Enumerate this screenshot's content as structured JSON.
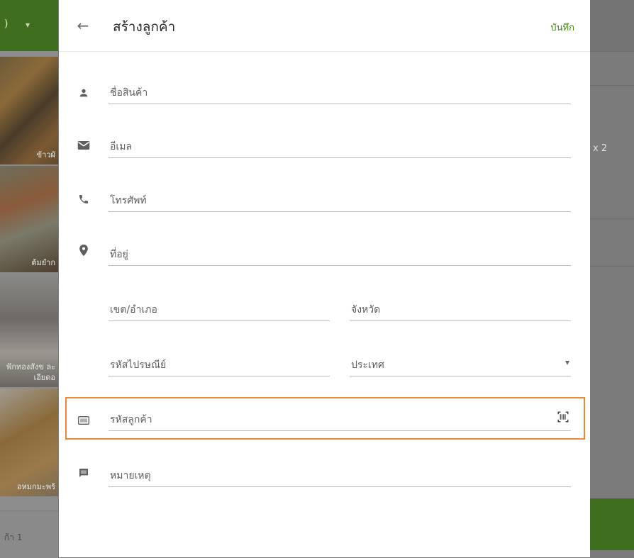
{
  "background": {
    "header_fragment": ")",
    "foods": [
      {
        "label": "ข้าวผั"
      },
      {
        "label": "ต้มยำก"
      },
      {
        "label": "ฟักทองสังข ละเอียดอ"
      },
      {
        "label": "อหมกมะพร้"
      }
    ],
    "bottom_left_label": "ก้า 1",
    "right_qty": "x 2",
    "brand_green": "#3f6e1f"
  },
  "dialog": {
    "title": "สร้างลูกค้า",
    "save_label": "บันทึก",
    "accent_color": "#4a8a1c",
    "fields": {
      "name": {
        "placeholder": "ชื่อสินค้า",
        "icon": "person-icon"
      },
      "email": {
        "placeholder": "อีเมล",
        "icon": "email-icon"
      },
      "phone": {
        "placeholder": "โทรศัพท์",
        "icon": "phone-icon"
      },
      "address": {
        "placeholder": "ที่อยู่",
        "icon": "location-pin-icon"
      },
      "district": {
        "placeholder": "เขต/อำเภอ"
      },
      "province": {
        "placeholder": "จังหวัด"
      },
      "postcode": {
        "placeholder": "รหัสไปรษณีย์"
      },
      "country": {
        "placeholder": "ประเทศ"
      },
      "customer_code": {
        "placeholder": "รหัสลูกค้า",
        "icon": "card-icon",
        "trailing_icon": "barcode-scan-icon"
      },
      "note": {
        "placeholder": "หมายเหตุ",
        "icon": "comment-icon"
      }
    },
    "highlight_color": "#f0883a"
  }
}
